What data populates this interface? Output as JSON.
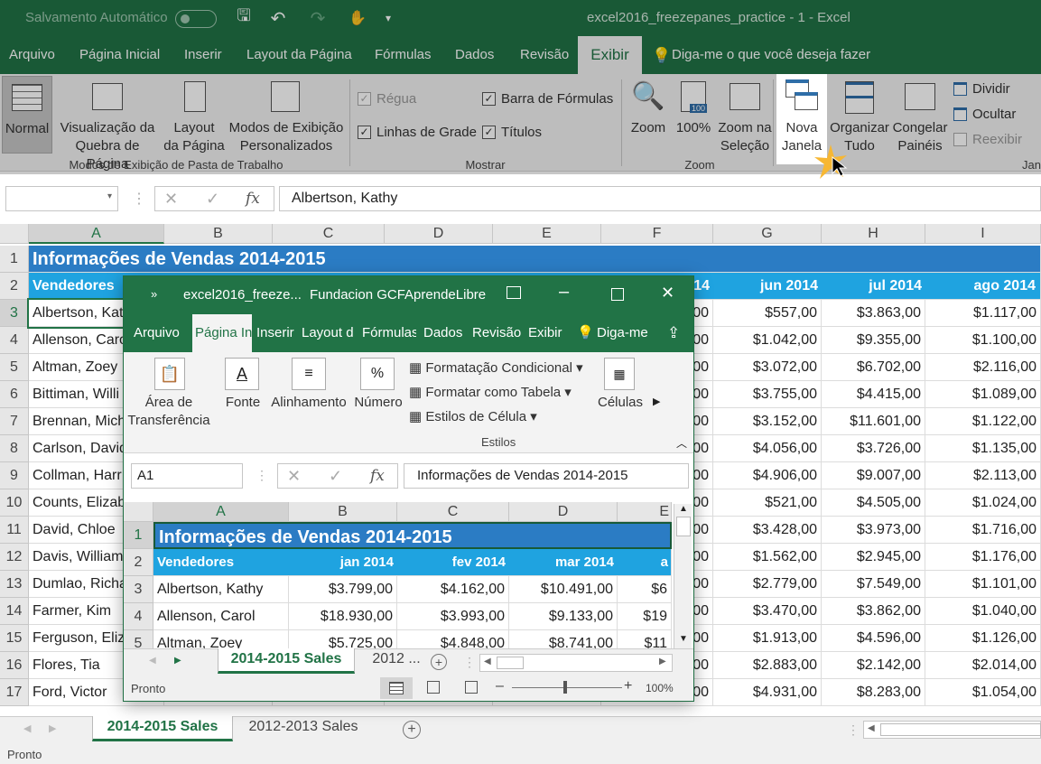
{
  "titlebar": {
    "autosave": "Salvamento Automático",
    "title": "excel2016_freezepanes_practice  -  1  -  Excel"
  },
  "tabs": [
    "Arquivo",
    "Página Inicial",
    "Inserir",
    "Layout da Página",
    "Fórmulas",
    "Dados",
    "Revisão",
    "Exibir"
  ],
  "tell_me": "Diga-me o que você deseja fazer",
  "ribbon": {
    "normal": "Normal",
    "page_break": "Visualização da\nQuebra de Página",
    "page_layout": "Layout\nda Página",
    "custom_views": "Modos de Exibição\nPersonalizados",
    "group_views": "Modos de Exibição de Pasta de Trabalho",
    "ruler": "Régua",
    "gridlines": "Linhas de Grade",
    "formula_bar": "Barra de Fórmulas",
    "headings": "Títulos",
    "group_show": "Mostrar",
    "zoom": "Zoom",
    "zoom100": "100%",
    "zoom_selection": "Zoom na\nSeleção",
    "group_zoom": "Zoom",
    "new_window": "Nova\nJanela",
    "arrange_all": "Organizar\nTudo",
    "freeze_panes": "Congelar\nPainéis",
    "split": "Dividir",
    "hide": "Ocultar",
    "unhide": "Reexibir",
    "group_window": "Jan"
  },
  "formula": {
    "namebox": "",
    "fx": "fx",
    "value": "Albertson, Kathy"
  },
  "columns": [
    "A",
    "B",
    "C",
    "D",
    "E",
    "F",
    "G",
    "H",
    "I"
  ],
  "rows": [
    "1",
    "2",
    "3",
    "4",
    "5",
    "6",
    "7",
    "8",
    "9",
    "10",
    "11",
    "12",
    "13",
    "14",
    "15",
    "16",
    "17"
  ],
  "title_row": "Informações de Vendas 2014-2015",
  "header_row": {
    "A": "Vendedores",
    "F": "14",
    "G": "jun 2014",
    "H": "jul 2014",
    "I": "ago 2014"
  },
  "data_rows": [
    {
      "A": "Albertson, Kat",
      "F": "00",
      "G": "$557,00",
      "H": "$3.863,00",
      "I": "$1.117,00"
    },
    {
      "A": "Allenson, Caro",
      "F": "00",
      "G": "$1.042,00",
      "H": "$9.355,00",
      "I": "$1.100,00"
    },
    {
      "A": "Altman, Zoey",
      "F": "00",
      "G": "$3.072,00",
      "H": "$6.702,00",
      "I": "$2.116,00"
    },
    {
      "A": "Bittiman, Willi",
      "F": "00",
      "G": "$3.755,00",
      "H": "$4.415,00",
      "I": "$1.089,00"
    },
    {
      "A": "Brennan, Mich",
      "F": "00",
      "G": "$3.152,00",
      "H": "$11.601,00",
      "I": "$1.122,00"
    },
    {
      "A": "Carlson, David",
      "F": "00",
      "G": "$4.056,00",
      "H": "$3.726,00",
      "I": "$1.135,00"
    },
    {
      "A": "Collman, Harr",
      "F": "00",
      "G": "$4.906,00",
      "H": "$9.007,00",
      "I": "$2.113,00"
    },
    {
      "A": "Counts, Elizab",
      "F": "00",
      "G": "$521,00",
      "H": "$4.505,00",
      "I": "$1.024,00"
    },
    {
      "A": "David, Chloe",
      "F": "00",
      "G": "$3.428,00",
      "H": "$3.973,00",
      "I": "$1.716,00"
    },
    {
      "A": "Davis, William",
      "F": "00",
      "G": "$1.562,00",
      "H": "$2.945,00",
      "I": "$1.176,00"
    },
    {
      "A": "Dumlao, Richa",
      "F": "00",
      "G": "$2.779,00",
      "H": "$7.549,00",
      "I": "$1.101,00"
    },
    {
      "A": "Farmer, Kim",
      "F": "00",
      "G": "$3.470,00",
      "H": "$3.862,00",
      "I": "$1.040,00"
    },
    {
      "A": "Ferguson, Eliz",
      "F": "00",
      "G": "$1.913,00",
      "H": "$4.596,00",
      "I": "$1.126,00"
    },
    {
      "A": "Flores, Tia",
      "F": "00",
      "G": "$2.883,00",
      "H": "$2.142,00",
      "I": "$2.014,00"
    },
    {
      "A": "Ford, Victor",
      "F": "00",
      "G": "$4.931,00",
      "H": "$8.283,00",
      "I": "$1.054,00"
    }
  ],
  "sheets": [
    "2014-2015 Sales",
    "2012-2013 Sales"
  ],
  "status": "Pronto",
  "win": {
    "title_file": "excel2016_freeze...",
    "title_app": "Fundacion GCFAprendeLibre",
    "tabs": [
      "Arquivo",
      "Página In",
      "Inserir",
      "Layout d",
      "Fórmulas",
      "Dados",
      "Revisão",
      "Exibir"
    ],
    "tell_me": "Diga-me",
    "clipboard": "Área de\nTransferência",
    "font": "Fonte",
    "alignment": "Alinhamento",
    "number": "Número",
    "cond_format": "Formatação Condicional",
    "format_table": "Formatar como Tabela",
    "cell_styles": "Estilos de Célula",
    "styles_group": "Estilos",
    "cells": "Células",
    "namebox": "A1",
    "fx": "fx",
    "formula_value": "Informações de Vendas 2014-2015",
    "columns": [
      "A",
      "B",
      "C",
      "D",
      "E"
    ],
    "rows": [
      "1",
      "2",
      "3",
      "4",
      "5"
    ],
    "title_row": "Informações de Vendas 2014-2015",
    "header": [
      "Vendedores",
      "jan 2014",
      "fev 2014",
      "mar 2014",
      "a"
    ],
    "data": [
      [
        "Albertson, Kathy",
        "$3.799,00",
        "$4.162,00",
        "$10.491,00",
        "$6"
      ],
      [
        "Allenson, Carol",
        "$18.930,00",
        "$3.993,00",
        "$9.133,00",
        "$19"
      ],
      [
        "Altman, Zoey",
        "$5.725,00",
        "$4.848,00",
        "$8.741,00",
        "$11"
      ]
    ],
    "sheet_active": "2014-2015 Sales",
    "sheet_other": "2012 ...",
    "status": "Pronto",
    "zoom": "100%"
  }
}
